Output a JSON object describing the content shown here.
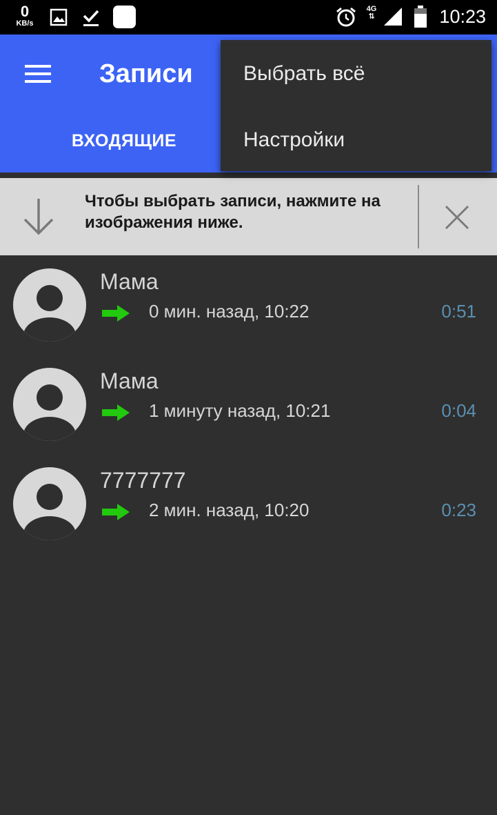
{
  "status_bar": {
    "speed_value": "0",
    "speed_unit": "KB/s",
    "network": "4G",
    "time": "10:23",
    "icons": [
      "image-icon",
      "check-icon",
      "app-square-icon",
      "alarm-icon",
      "signal-icon",
      "battery-icon"
    ]
  },
  "app_bar": {
    "title": "Записи",
    "tab_incoming": "ВХОДЯЩИЕ",
    "color": "#3d63f5"
  },
  "overflow_menu": {
    "items": [
      {
        "label": "Выбрать всё"
      },
      {
        "label": "Настройки"
      }
    ]
  },
  "hint": {
    "text": "Чтобы выбрать записи, нажмите на изображения ниже."
  },
  "calls": [
    {
      "name": "Мама",
      "time": "0 мин. назад, 10:22",
      "duration": "0:51",
      "direction_icon": "outgoing-arrow-icon"
    },
    {
      "name": "Мама",
      "time": "1 минуту назад, 10:21",
      "duration": "0:04",
      "direction_icon": "outgoing-arrow-icon"
    },
    {
      "name": "7777777",
      "time": "2 мин. назад, 10:20",
      "duration": "0:23",
      "direction_icon": "outgoing-arrow-icon"
    }
  ],
  "colors": {
    "background": "#2f2f2f",
    "accent": "#3d63f5",
    "duration": "#5a8fb0",
    "arrow": "#22c90e",
    "hint_bg": "#d9d9d9"
  }
}
